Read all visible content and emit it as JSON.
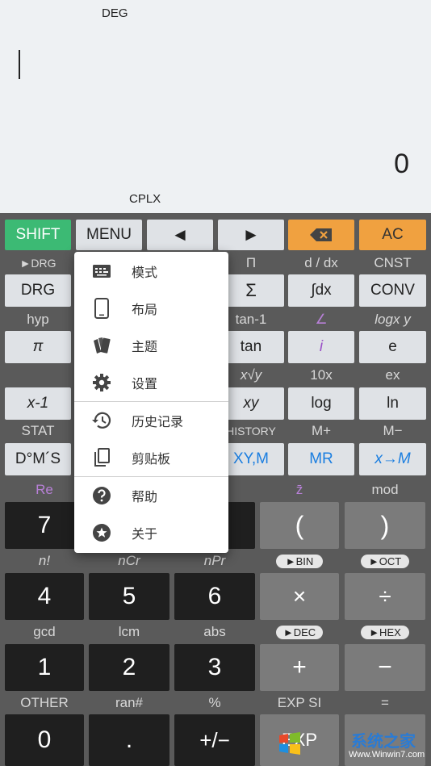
{
  "display": {
    "angle_mode": "DEG",
    "result": "0",
    "cplx": "CPLX"
  },
  "top_row": {
    "shift": "SHIFT",
    "menu": "MENU",
    "left": "◄",
    "right": "►",
    "ac": "AC"
  },
  "sci_labels_1": [
    "►DRG",
    "",
    "",
    "Π",
    "d / dx",
    "CNST"
  ],
  "sci_keys_1": [
    "DRG",
    "",
    "",
    "Σ",
    "∫dx",
    "CONV"
  ],
  "sci_labels_2": [
    "hyp",
    "",
    "",
    "tan-1",
    "∠",
    "logx y"
  ],
  "sci_keys_2": [
    "π",
    "",
    "",
    "tan",
    "i",
    "e"
  ],
  "sci_labels_3": [
    "",
    "",
    "",
    "x√y",
    "10x",
    "ex"
  ],
  "sci_keys_3": [
    "x-1",
    "",
    "",
    "xy",
    "log",
    "ln"
  ],
  "sci_labels_4": [
    "STAT",
    "",
    "",
    "HISTORY",
    "M+",
    "M−"
  ],
  "sci_keys_4": [
    "D°M´S",
    "",
    "",
    "XY,M",
    "MR",
    "x→M"
  ],
  "num_labels_1": [
    "Re",
    "",
    "",
    "z̄",
    "mod"
  ],
  "num_keys_1": [
    "7",
    "",
    "",
    "(",
    ")"
  ],
  "num_labels_2": [
    "n!",
    "nCr",
    "nPr",
    "►BIN",
    "►OCT"
  ],
  "num_keys_2": [
    "4",
    "5",
    "6",
    "×",
    "÷"
  ],
  "num_labels_3": [
    "gcd",
    "lcm",
    "abs",
    "►DEC",
    "►HEX"
  ],
  "num_keys_3": [
    "1",
    "2",
    "3",
    "+",
    "−"
  ],
  "num_labels_4": [
    "OTHER",
    "ran#",
    "%",
    "EXP SI",
    "="
  ],
  "num_keys_4": [
    "0",
    ".",
    "+/−",
    "EXP",
    ""
  ],
  "menu": {
    "items": [
      {
        "label": "模式",
        "icon": "keyboard-icon"
      },
      {
        "label": "布局",
        "icon": "tablet-icon"
      },
      {
        "label": "主题",
        "icon": "palette-icon"
      },
      {
        "label": "设置",
        "icon": "gear-icon"
      },
      {
        "label": "历史记录",
        "icon": "history-icon"
      },
      {
        "label": "剪贴板",
        "icon": "clipboard-icon"
      },
      {
        "label": "帮助",
        "icon": "help-icon"
      },
      {
        "label": "关于",
        "icon": "star-badge-icon"
      }
    ]
  },
  "watermark": {
    "text": "系统之家",
    "url": "Www.Winwin7.com"
  },
  "colors": {
    "shift": "#3cba74",
    "backspace": "#f0a140",
    "accent_blue": "#1b7ee0",
    "purple": "#b880d8"
  }
}
